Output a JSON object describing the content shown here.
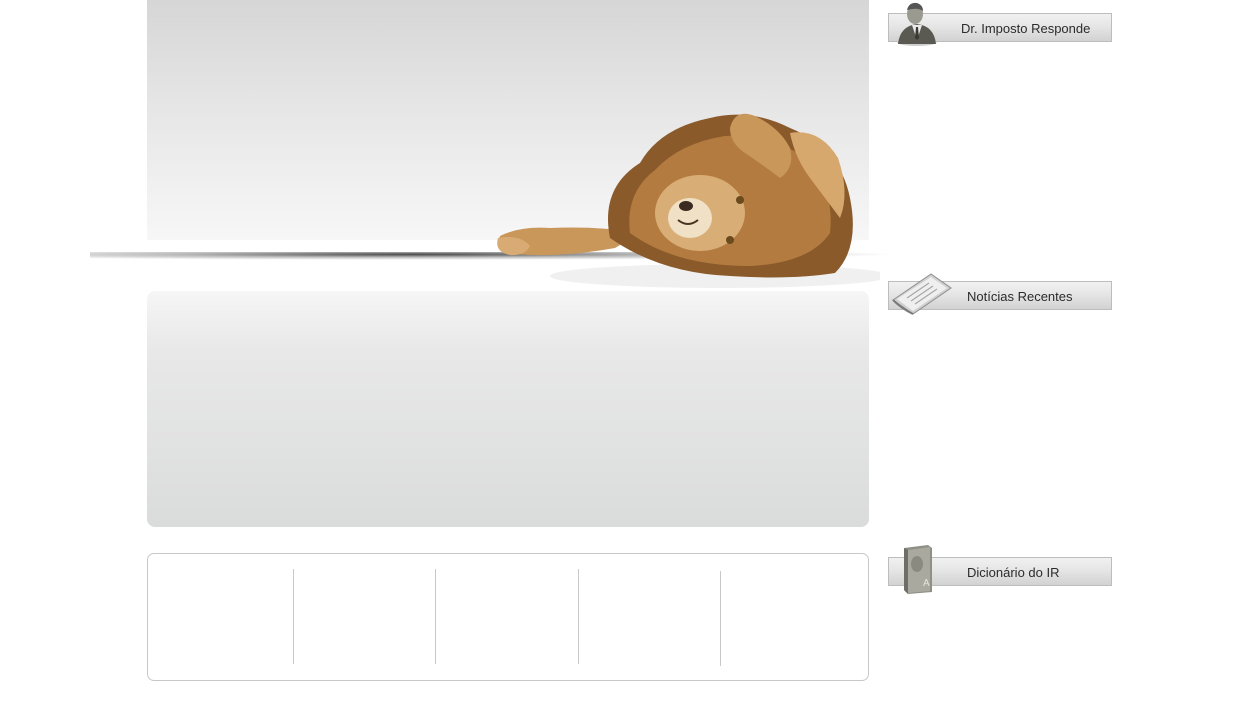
{
  "sidebar": {
    "items": [
      {
        "label": "Dr. Imposto Responde",
        "icon": "person-icon"
      },
      {
        "label": "Notícias Recentes",
        "icon": "newspaper-icon"
      },
      {
        "label": "Dicionário do IR",
        "icon": "book-icon"
      }
    ]
  },
  "hero": {
    "image": "lion-illustration"
  },
  "colors": {
    "panel_top": "#d6d6d6",
    "panel_bottom": "#f7f7f7",
    "button_border": "#bdbdbd",
    "text": "#2b2b2b"
  }
}
